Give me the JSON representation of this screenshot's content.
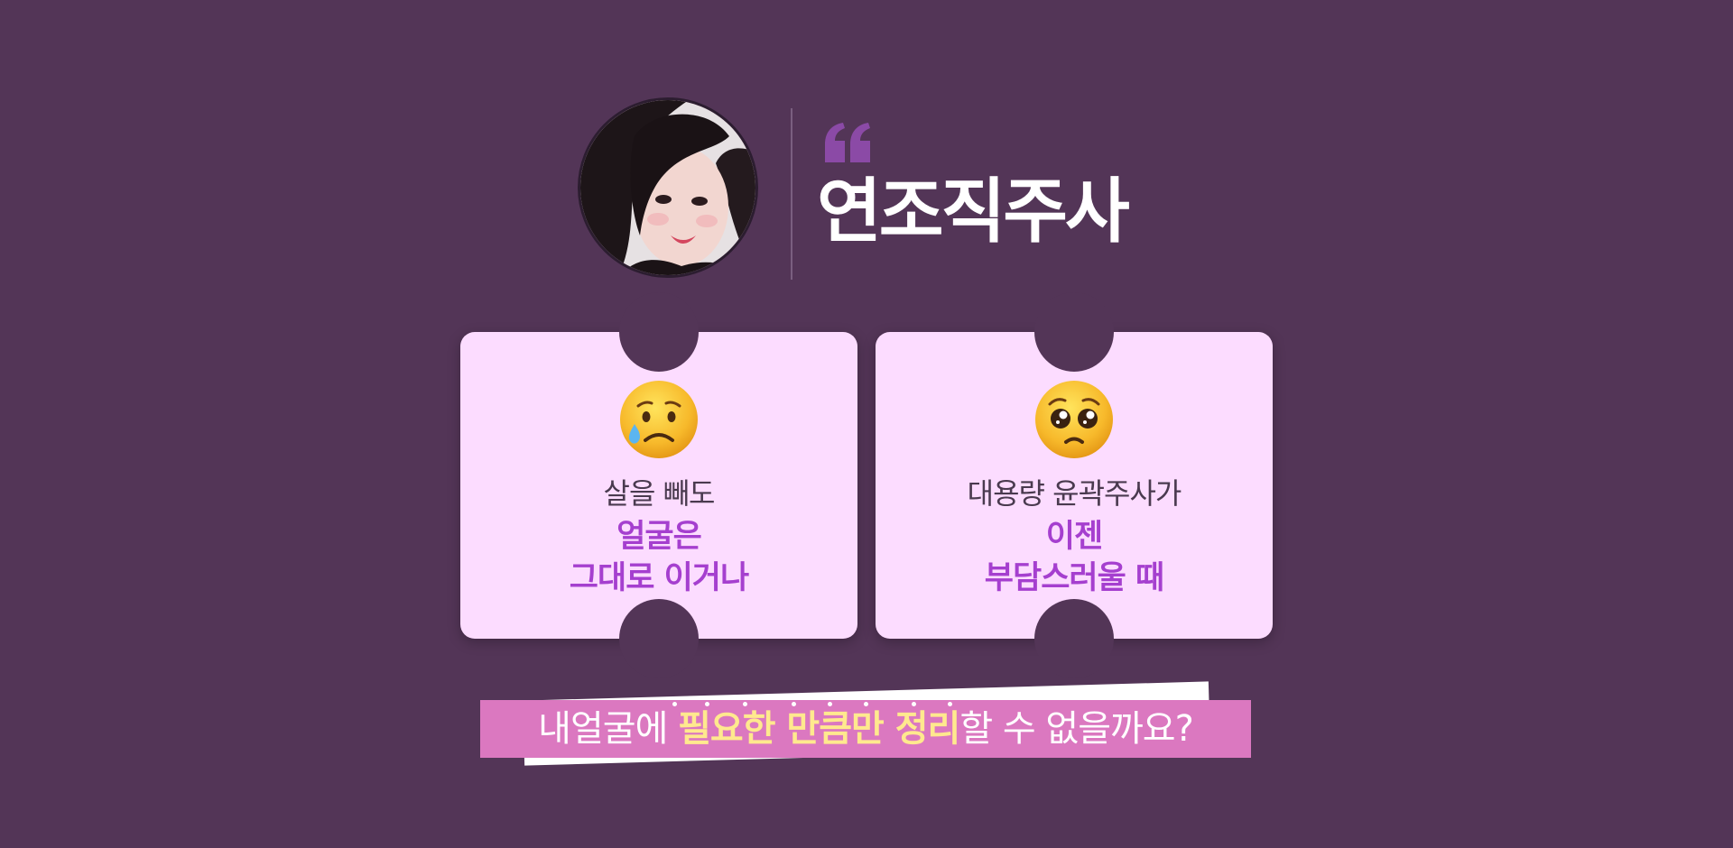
{
  "header": {
    "avatar_alt": "profile photo",
    "title": "연조직주사",
    "accent_color": "#8b4aa6"
  },
  "cards": [
    {
      "emoji": "crying-face",
      "line1": "살을 빼도",
      "line2": "얼굴은",
      "line3": "그대로 이거나"
    },
    {
      "emoji": "pleading-face",
      "line1": "대용량 윤곽주사가",
      "line2": "이젠",
      "line3": "부담스러울 때"
    }
  ],
  "banner": {
    "prefix": "내얼굴에 ",
    "highlight": "필요한 만큼만 정리",
    "suffix": "할 수 없을까요?"
  },
  "colors": {
    "background": "#533557",
    "card": "#fcdcff",
    "card_accent_text": "#a53fcf",
    "banner": "#db78c0",
    "banner_highlight": "#ffe98e"
  }
}
